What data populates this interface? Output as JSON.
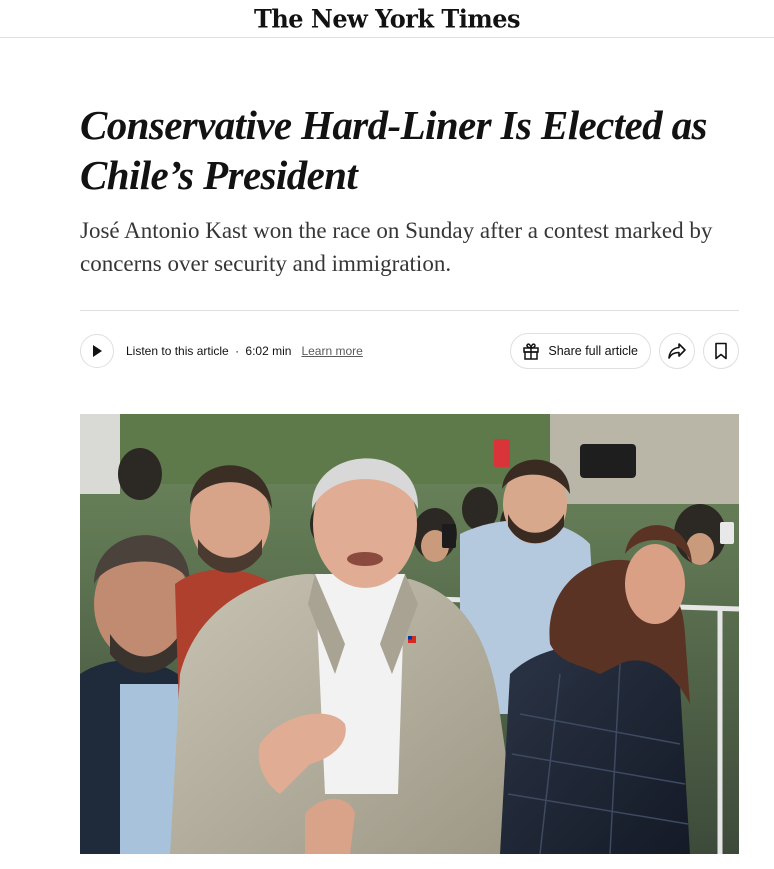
{
  "masthead": {
    "logo_text": "The New York Times"
  },
  "article": {
    "headline": "Conservative Hard-Liner Is Elected as Chile’s President",
    "summary": "José Antonio Kast won the race on Sunday after a contest marked by concerns over security and immigration."
  },
  "toolbar": {
    "listen_label": "Listen to this article",
    "separator": "·",
    "duration": "6:02 min",
    "learn_more": "Learn more",
    "share_label": "Share full article",
    "icons": {
      "play": "play-icon",
      "gift": "gift-icon",
      "share": "share-arrow-icon",
      "bookmark": "bookmark-icon"
    }
  },
  "photo": {
    "subject": "news-photo"
  },
  "colors": {
    "text": "#121212",
    "summary": "#363636",
    "border": "#dfdfdf"
  }
}
